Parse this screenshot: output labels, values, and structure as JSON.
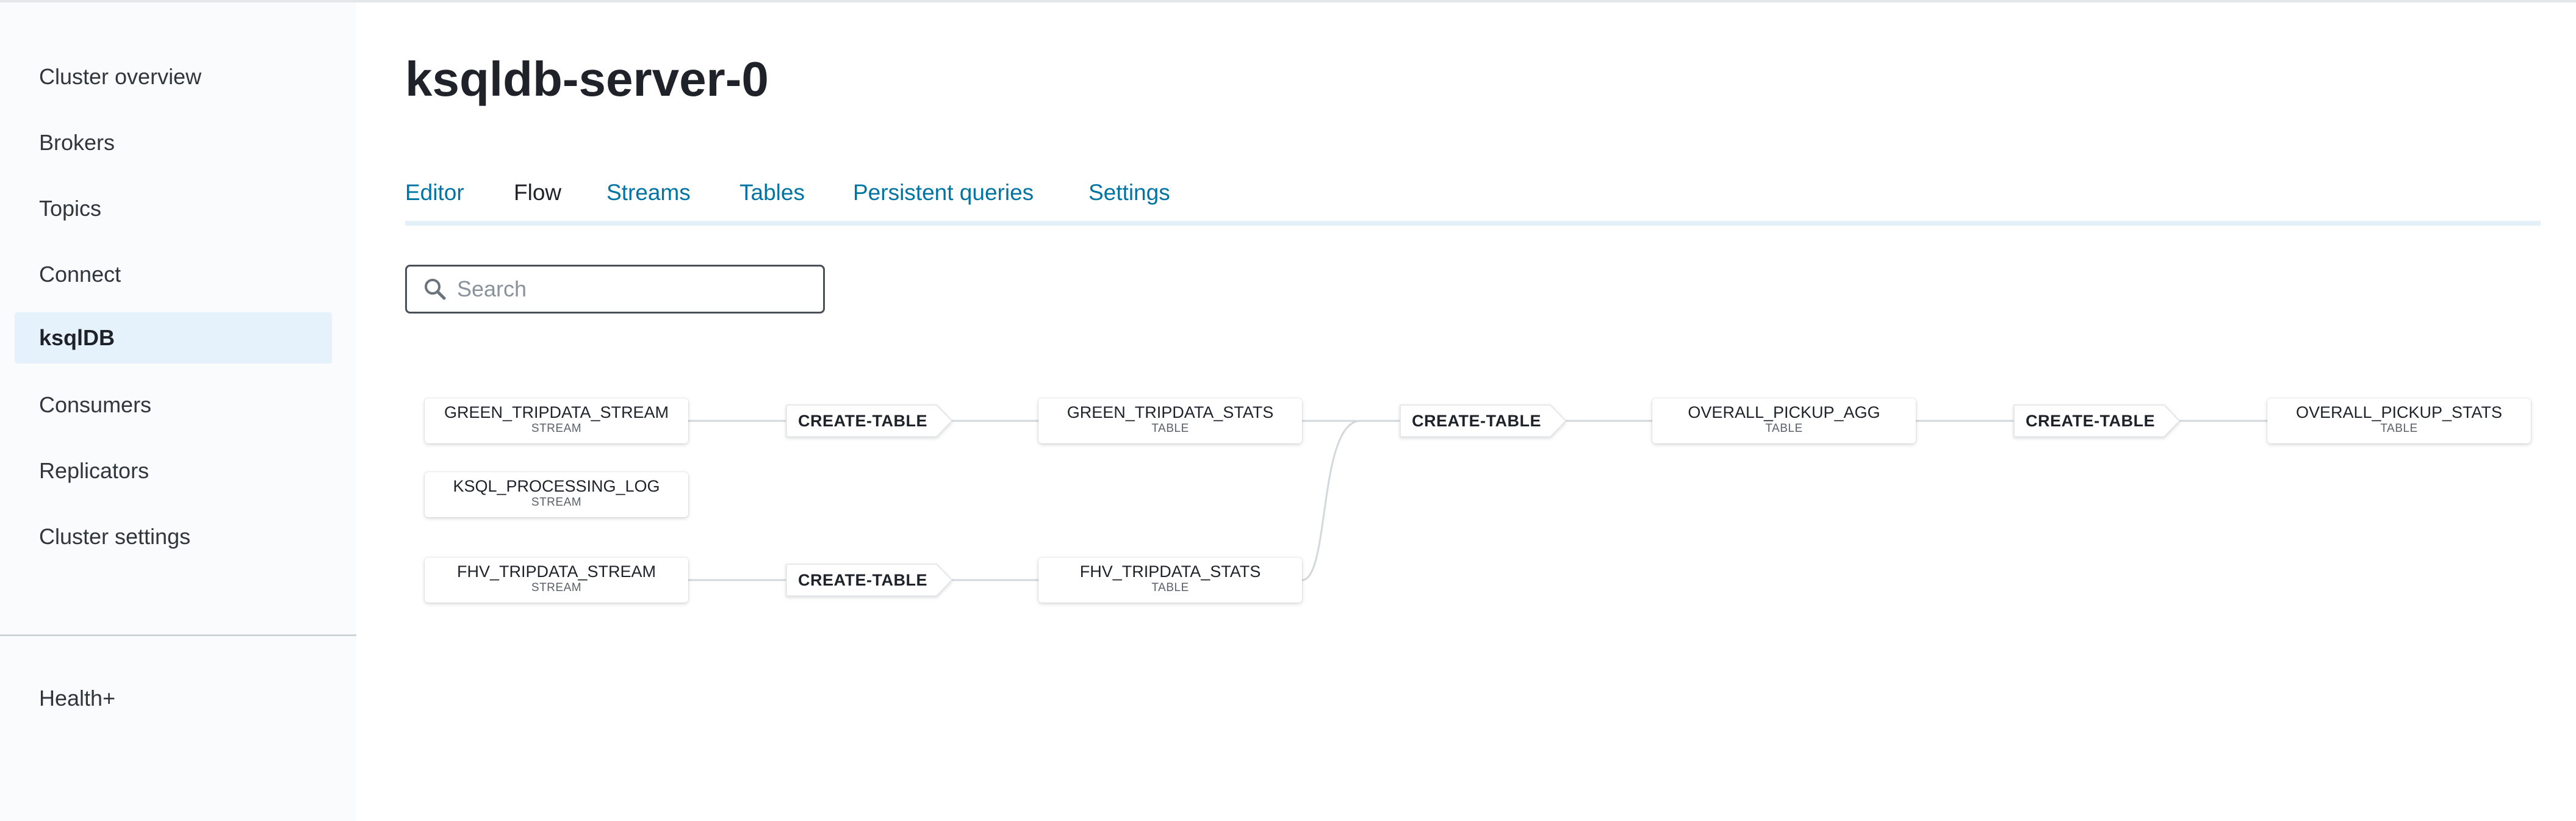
{
  "sidebar": {
    "items": [
      {
        "label": "Cluster overview",
        "active": false
      },
      {
        "label": "Brokers",
        "active": false
      },
      {
        "label": "Topics",
        "active": false
      },
      {
        "label": "Connect",
        "active": false
      },
      {
        "label": "ksqlDB",
        "active": true
      },
      {
        "label": "Consumers",
        "active": false
      },
      {
        "label": "Replicators",
        "active": false
      },
      {
        "label": "Cluster settings",
        "active": false
      }
    ],
    "footer_label": "Health+"
  },
  "page": {
    "title": "ksqldb-server-0"
  },
  "tabs": [
    {
      "label": "Editor",
      "active": false
    },
    {
      "label": "Flow",
      "active": true
    },
    {
      "label": "Streams",
      "active": false
    },
    {
      "label": "Tables",
      "active": false
    },
    {
      "label": "Persistent queries",
      "active": false
    },
    {
      "label": "Settings",
      "active": false
    }
  ],
  "search": {
    "placeholder": "Search",
    "value": ""
  },
  "flow": {
    "nodes": [
      {
        "name": "GREEN_TRIPDATA_STREAM",
        "type": "STREAM"
      },
      {
        "name": "KSQL_PROCESSING_LOG",
        "type": "STREAM"
      },
      {
        "name": "FHV_TRIPDATA_STREAM",
        "type": "STREAM"
      },
      {
        "name": "GREEN_TRIPDATA_STATS",
        "type": "TABLE"
      },
      {
        "name": "FHV_TRIPDATA_STATS",
        "type": "TABLE"
      },
      {
        "name": "OVERALL_PICKUP_AGG",
        "type": "TABLE"
      },
      {
        "name": "OVERALL_PICKUP_STATS",
        "type": "TABLE"
      }
    ],
    "operations": [
      {
        "label": "CREATE-TABLE"
      },
      {
        "label": "CREATE-TABLE"
      },
      {
        "label": "CREATE-TABLE"
      },
      {
        "label": "CREATE-TABLE"
      }
    ]
  },
  "colors": {
    "accent": "#0074a2",
    "active_nav_bg": "#e5f2fb",
    "tab_rule": "#e3f0f7",
    "connector": "#d3d8dc"
  },
  "icons": {
    "search": "search-icon"
  }
}
